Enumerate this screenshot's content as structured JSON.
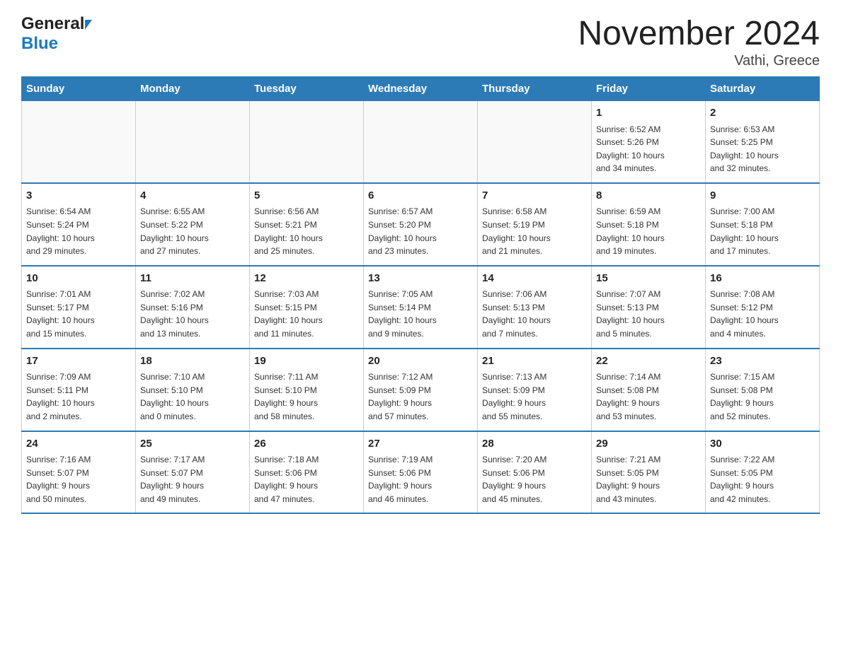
{
  "header": {
    "logo_general": "General",
    "logo_blue": "Blue",
    "month_title": "November 2024",
    "location": "Vathi, Greece"
  },
  "weekdays": [
    "Sunday",
    "Monday",
    "Tuesday",
    "Wednesday",
    "Thursday",
    "Friday",
    "Saturday"
  ],
  "weeks": [
    [
      {
        "day": "",
        "info": ""
      },
      {
        "day": "",
        "info": ""
      },
      {
        "day": "",
        "info": ""
      },
      {
        "day": "",
        "info": ""
      },
      {
        "day": "",
        "info": ""
      },
      {
        "day": "1",
        "info": "Sunrise: 6:52 AM\nSunset: 5:26 PM\nDaylight: 10 hours\nand 34 minutes."
      },
      {
        "day": "2",
        "info": "Sunrise: 6:53 AM\nSunset: 5:25 PM\nDaylight: 10 hours\nand 32 minutes."
      }
    ],
    [
      {
        "day": "3",
        "info": "Sunrise: 6:54 AM\nSunset: 5:24 PM\nDaylight: 10 hours\nand 29 minutes."
      },
      {
        "day": "4",
        "info": "Sunrise: 6:55 AM\nSunset: 5:22 PM\nDaylight: 10 hours\nand 27 minutes."
      },
      {
        "day": "5",
        "info": "Sunrise: 6:56 AM\nSunset: 5:21 PM\nDaylight: 10 hours\nand 25 minutes."
      },
      {
        "day": "6",
        "info": "Sunrise: 6:57 AM\nSunset: 5:20 PM\nDaylight: 10 hours\nand 23 minutes."
      },
      {
        "day": "7",
        "info": "Sunrise: 6:58 AM\nSunset: 5:19 PM\nDaylight: 10 hours\nand 21 minutes."
      },
      {
        "day": "8",
        "info": "Sunrise: 6:59 AM\nSunset: 5:18 PM\nDaylight: 10 hours\nand 19 minutes."
      },
      {
        "day": "9",
        "info": "Sunrise: 7:00 AM\nSunset: 5:18 PM\nDaylight: 10 hours\nand 17 minutes."
      }
    ],
    [
      {
        "day": "10",
        "info": "Sunrise: 7:01 AM\nSunset: 5:17 PM\nDaylight: 10 hours\nand 15 minutes."
      },
      {
        "day": "11",
        "info": "Sunrise: 7:02 AM\nSunset: 5:16 PM\nDaylight: 10 hours\nand 13 minutes."
      },
      {
        "day": "12",
        "info": "Sunrise: 7:03 AM\nSunset: 5:15 PM\nDaylight: 10 hours\nand 11 minutes."
      },
      {
        "day": "13",
        "info": "Sunrise: 7:05 AM\nSunset: 5:14 PM\nDaylight: 10 hours\nand 9 minutes."
      },
      {
        "day": "14",
        "info": "Sunrise: 7:06 AM\nSunset: 5:13 PM\nDaylight: 10 hours\nand 7 minutes."
      },
      {
        "day": "15",
        "info": "Sunrise: 7:07 AM\nSunset: 5:13 PM\nDaylight: 10 hours\nand 5 minutes."
      },
      {
        "day": "16",
        "info": "Sunrise: 7:08 AM\nSunset: 5:12 PM\nDaylight: 10 hours\nand 4 minutes."
      }
    ],
    [
      {
        "day": "17",
        "info": "Sunrise: 7:09 AM\nSunset: 5:11 PM\nDaylight: 10 hours\nand 2 minutes."
      },
      {
        "day": "18",
        "info": "Sunrise: 7:10 AM\nSunset: 5:10 PM\nDaylight: 10 hours\nand 0 minutes."
      },
      {
        "day": "19",
        "info": "Sunrise: 7:11 AM\nSunset: 5:10 PM\nDaylight: 9 hours\nand 58 minutes."
      },
      {
        "day": "20",
        "info": "Sunrise: 7:12 AM\nSunset: 5:09 PM\nDaylight: 9 hours\nand 57 minutes."
      },
      {
        "day": "21",
        "info": "Sunrise: 7:13 AM\nSunset: 5:09 PM\nDaylight: 9 hours\nand 55 minutes."
      },
      {
        "day": "22",
        "info": "Sunrise: 7:14 AM\nSunset: 5:08 PM\nDaylight: 9 hours\nand 53 minutes."
      },
      {
        "day": "23",
        "info": "Sunrise: 7:15 AM\nSunset: 5:08 PM\nDaylight: 9 hours\nand 52 minutes."
      }
    ],
    [
      {
        "day": "24",
        "info": "Sunrise: 7:16 AM\nSunset: 5:07 PM\nDaylight: 9 hours\nand 50 minutes."
      },
      {
        "day": "25",
        "info": "Sunrise: 7:17 AM\nSunset: 5:07 PM\nDaylight: 9 hours\nand 49 minutes."
      },
      {
        "day": "26",
        "info": "Sunrise: 7:18 AM\nSunset: 5:06 PM\nDaylight: 9 hours\nand 47 minutes."
      },
      {
        "day": "27",
        "info": "Sunrise: 7:19 AM\nSunset: 5:06 PM\nDaylight: 9 hours\nand 46 minutes."
      },
      {
        "day": "28",
        "info": "Sunrise: 7:20 AM\nSunset: 5:06 PM\nDaylight: 9 hours\nand 45 minutes."
      },
      {
        "day": "29",
        "info": "Sunrise: 7:21 AM\nSunset: 5:05 PM\nDaylight: 9 hours\nand 43 minutes."
      },
      {
        "day": "30",
        "info": "Sunrise: 7:22 AM\nSunset: 5:05 PM\nDaylight: 9 hours\nand 42 minutes."
      }
    ]
  ]
}
